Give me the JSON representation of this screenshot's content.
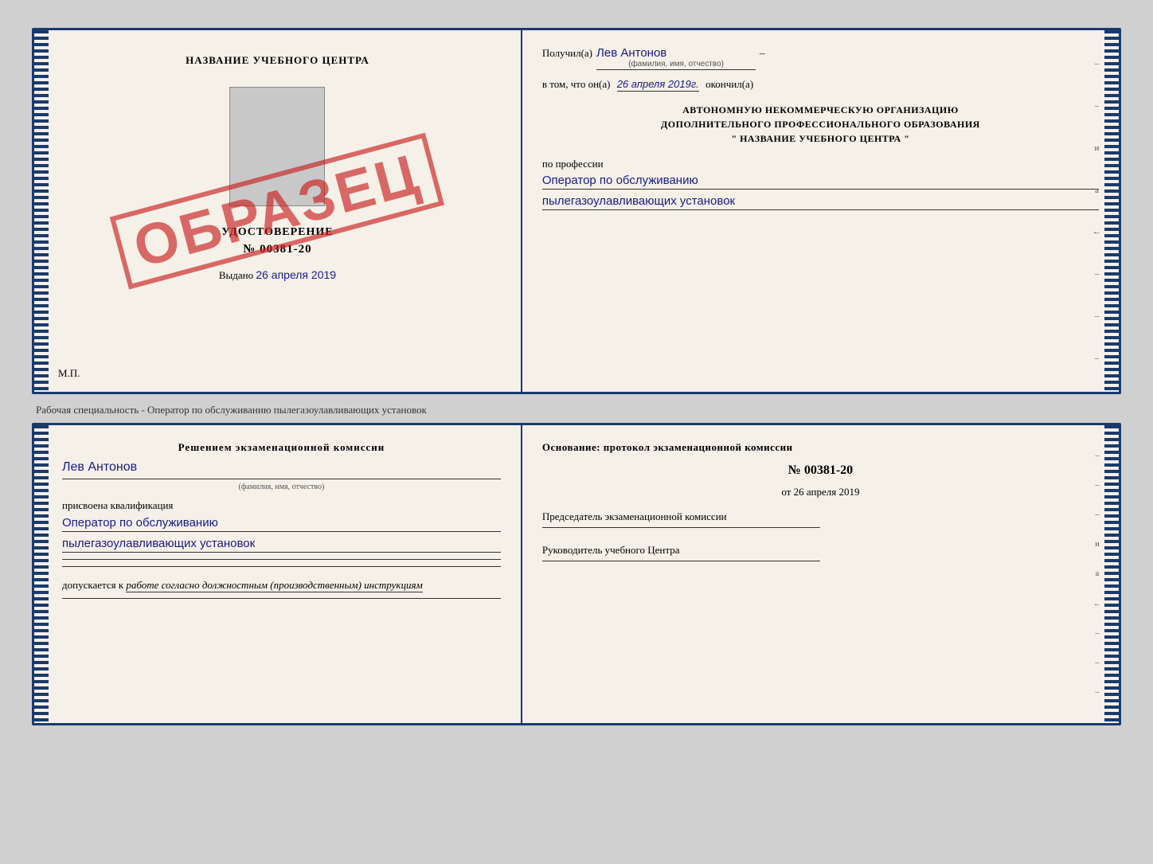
{
  "page": {
    "background_color": "#d0d0d0"
  },
  "top_document": {
    "left": {
      "title": "НАЗВАНИЕ УЧЕБНОГО ЦЕНТРА",
      "cert_type": "УДОСТОВЕРЕНИЕ",
      "cert_number": "№ 00381-20",
      "issued_label": "Выдано",
      "issued_date": "26 апреля 2019",
      "mp_label": "М.П.",
      "stamp_text": "ОБРАЗЕЦ"
    },
    "right": {
      "received_label": "Получил(а)",
      "received_name": "Лев Антонов",
      "fio_sublabel": "(фамилия, имя, отчество)",
      "completed_prefix": "в том, что он(а)",
      "completed_date": "26 апреля 2019г.",
      "completed_suffix": "окончил(а)",
      "org_line1": "АВТОНОМНУЮ НЕКОММЕРЧЕСКУЮ ОРГАНИЗАЦИЮ",
      "org_line2": "ДОПОЛНИТЕЛЬНОГО ПРОФЕССИОНАЛЬНОГО ОБРАЗОВАНИЯ",
      "org_line3": "\"  НАЗВАНИЕ УЧЕБНОГО ЦЕНТРА  \"",
      "profession_label": "по профессии",
      "profession_line1": "Оператор по обслуживанию",
      "profession_line2": "пылегазоулавливающих установок",
      "side_marks": [
        "–",
        "–",
        "и",
        "а",
        "←",
        "–",
        "–",
        "–"
      ]
    }
  },
  "separator": {
    "text": "Рабочая специальность - Оператор по обслуживанию пылегазоулавливающих установок"
  },
  "bottom_document": {
    "left": {
      "decision_title": "Решением экзаменационной комиссии",
      "person_name": "Лев Антонов",
      "fio_sublabel": "(фамилия, имя, отчество)",
      "qualification_label": "присвоена квалификация",
      "qualification_line1": "Оператор по обслуживанию",
      "qualification_line2": "пылегазоулавливающих установок",
      "admission_label": "допускается к",
      "admission_text": "работе согласно должностным (производственным) инструкциям"
    },
    "right": {
      "basis_title": "Основание: протокол экзаменационной комиссии",
      "protocol_number": "№ 00381-20",
      "protocol_date_prefix": "от",
      "protocol_date": "26 апреля 2019",
      "chairman_label": "Председатель экзаменационной комиссии",
      "director_label": "Руководитель учебного Центра",
      "side_marks": [
        "–",
        "–",
        "–",
        "и",
        "а",
        "←",
        "–",
        "–",
        "–"
      ]
    }
  }
}
